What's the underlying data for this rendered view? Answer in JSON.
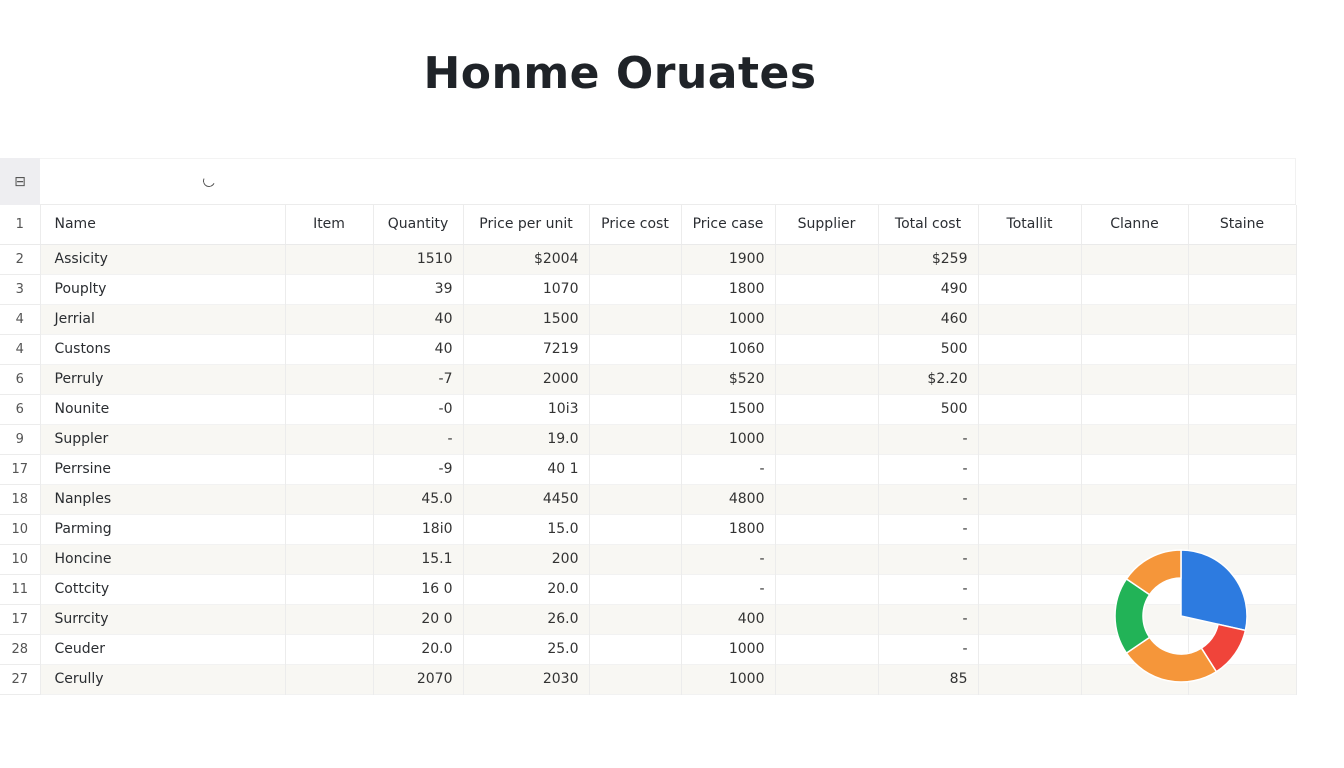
{
  "title": "Honme Oruates",
  "toolbar": {
    "corner_icon": "⊟",
    "loading_icon": "spinner"
  },
  "columns": [
    {
      "row_number": "1"
    },
    {
      "label": "Name"
    },
    {
      "label": "Item"
    },
    {
      "label": "Quantity"
    },
    {
      "label": "Price per unit"
    },
    {
      "label": "Price cost"
    },
    {
      "label": "Price case"
    },
    {
      "label": "Supplier"
    },
    {
      "label": "Total cost"
    },
    {
      "label": "Totallit"
    },
    {
      "label": "Clanne"
    },
    {
      "label": "Staine"
    }
  ],
  "rows": [
    {
      "num": "2",
      "name": "Assicity",
      "item": "",
      "quantity": "1510",
      "price_per_unit": "$2004",
      "price_cost": "",
      "price_case": "1900",
      "supplier": "",
      "total_cost": "$259",
      "totallit": "",
      "clanne": "",
      "staine": ""
    },
    {
      "num": "3",
      "name": "Pouplty",
      "item": "",
      "quantity": "39",
      "price_per_unit": "1070",
      "price_cost": "",
      "price_case": "1800",
      "supplier": "",
      "total_cost": "490",
      "totallit": "",
      "clanne": "",
      "staine": ""
    },
    {
      "num": "4",
      "name": "Jerrial",
      "item": "",
      "quantity": "40",
      "price_per_unit": "1500",
      "price_cost": "",
      "price_case": "1000",
      "supplier": "",
      "total_cost": "460",
      "totallit": "",
      "clanne": "",
      "staine": ""
    },
    {
      "num": "4",
      "name": "Custons",
      "item": "",
      "quantity": "40",
      "price_per_unit": "7219",
      "price_cost": "",
      "price_case": "1060",
      "supplier": "",
      "total_cost": "500",
      "totallit": "",
      "clanne": "",
      "staine": ""
    },
    {
      "num": "6",
      "name": "Perruly",
      "item": "",
      "quantity": "-7",
      "price_per_unit": "2000",
      "price_cost": "",
      "price_case": "$520",
      "supplier": "",
      "total_cost": "$2.20",
      "totallit": "",
      "clanne": "",
      "staine": ""
    },
    {
      "num": "6",
      "name": "Nounite",
      "item": "",
      "quantity": "-0",
      "price_per_unit": "10i3",
      "price_cost": "",
      "price_case": "1500",
      "supplier": "",
      "total_cost": "500",
      "totallit": "",
      "clanne": "",
      "staine": ""
    },
    {
      "num": "9",
      "name": "Suppler",
      "item": "",
      "quantity": "-",
      "price_per_unit": "19.0",
      "price_cost": "",
      "price_case": "1000",
      "supplier": "",
      "total_cost": "-",
      "totallit": "",
      "clanne": "",
      "staine": ""
    },
    {
      "num": "17",
      "name": "Perrsine",
      "item": "",
      "quantity": "-9",
      "price_per_unit": "40 1",
      "price_cost": "",
      "price_case": "-",
      "supplier": "",
      "total_cost": "-",
      "totallit": "",
      "clanne": "",
      "staine": ""
    },
    {
      "num": "18",
      "name": "Nanples",
      "item": "",
      "quantity": "45.0",
      "price_per_unit": "4450",
      "price_cost": "",
      "price_case": "4800",
      "supplier": "",
      "total_cost": "-",
      "totallit": "",
      "clanne": "",
      "staine": ""
    },
    {
      "num": "10",
      "name": "Parming",
      "item": "",
      "quantity": "18i0",
      "price_per_unit": "15.0",
      "price_cost": "",
      "price_case": "1800",
      "supplier": "",
      "total_cost": "-",
      "totallit": "",
      "clanne": "",
      "staine": ""
    },
    {
      "num": "10",
      "name": "Honcine",
      "item": "",
      "quantity": "15.1",
      "price_per_unit": "200",
      "price_cost": "",
      "price_case": "-",
      "supplier": "",
      "total_cost": "-",
      "totallit": "",
      "clanne": "",
      "staine": ""
    },
    {
      "num": "11",
      "name": "Cottcity",
      "item": "",
      "quantity": "16 0",
      "price_per_unit": "20.0",
      "price_cost": "",
      "price_case": "-",
      "supplier": "",
      "total_cost": "-",
      "totallit": "",
      "clanne": "",
      "staine": ""
    },
    {
      "num": "17",
      "name": "Surrcity",
      "item": "",
      "quantity": "20 0",
      "price_per_unit": "26.0",
      "price_cost": "",
      "price_case": "400",
      "supplier": "",
      "total_cost": "-",
      "totallit": "",
      "clanne": "",
      "staine": ""
    },
    {
      "num": "28",
      "name": "Ceuder",
      "item": "",
      "quantity": "20.0",
      "price_per_unit": "25.0",
      "price_cost": "",
      "price_case": "1000",
      "supplier": "",
      "total_cost": "-",
      "totallit": "",
      "clanne": "",
      "staine": ""
    },
    {
      "num": "27",
      "name": "Cerully",
      "item": "",
      "quantity": "2070",
      "price_per_unit": "2030",
      "price_cost": "",
      "price_case": "1000",
      "supplier": "",
      "total_cost": "85",
      "totallit": "",
      "clanne": "",
      "staine": ""
    }
  ],
  "donut": {
    "segments": [
      {
        "name": "blue",
        "fraction": 0.285,
        "color": "#2d7be0",
        "exploded": true
      },
      {
        "name": "red",
        "fraction": 0.125,
        "color": "#f0443a"
      },
      {
        "name": "orange-1",
        "fraction": 0.245,
        "color": "#f5963a"
      },
      {
        "name": "green",
        "fraction": 0.19,
        "color": "#22b357"
      },
      {
        "name": "orange-2",
        "fraction": 0.155,
        "color": "#f5963a"
      }
    ]
  }
}
